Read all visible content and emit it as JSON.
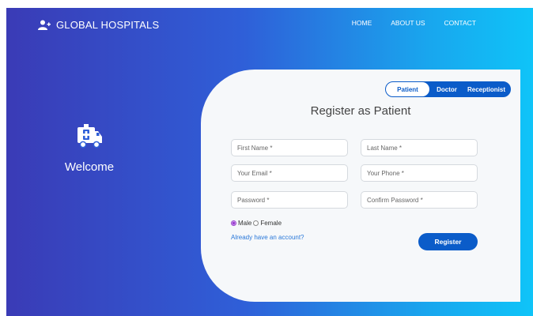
{
  "brand": {
    "name": "GLOBAL HOSPITALS",
    "icon": "add-user-icon"
  },
  "nav": {
    "home": "HOME",
    "about": "ABOUT US",
    "contact": "CONTACT"
  },
  "welcome": {
    "icon": "ambulance-icon",
    "text": "Welcome"
  },
  "tabs": {
    "patient": "Patient",
    "doctor": "Doctor",
    "receptionist": "Receptionist",
    "active": "Patient"
  },
  "form": {
    "title": "Register as Patient",
    "first_name_placeholder": "First Name *",
    "last_name_placeholder": "Last Name *",
    "email_placeholder": "Your Email *",
    "phone_placeholder": "Your Phone *",
    "password_placeholder": "Password *",
    "confirm_password_placeholder": "Confirm Password *",
    "gender_male": "Male",
    "gender_female": "Female",
    "gender_selected": "Male",
    "login_link": "Already have an account?",
    "register_label": "Register"
  },
  "colors": {
    "accent": "#0b5cc9",
    "gradient_start": "#3a3bb6",
    "gradient_end": "#0fc4f8",
    "card": "#f6f8fa"
  }
}
